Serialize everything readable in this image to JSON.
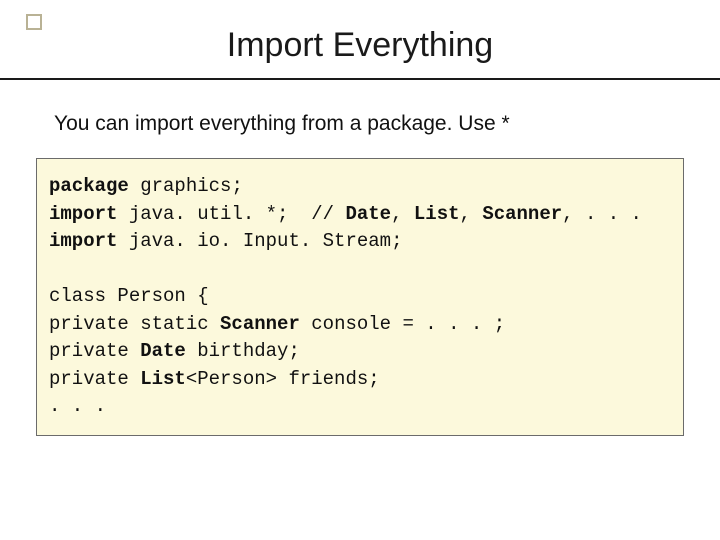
{
  "slide": {
    "title": "Import Everything",
    "subtitle": "You can import everything from a package.  Use *"
  },
  "code": {
    "l1a": "package",
    "l1b": " graphics;",
    "l2a": "import",
    "l2b": " java. util. *;  // ",
    "l2c": "Date",
    "l2d": ", ",
    "l2e": "List",
    "l2f": ", ",
    "l2g": "Scanner",
    "l2h": ", . . .",
    "l3a": "import",
    "l3b": " java. io. Input. Stream;",
    "blank": "",
    "l4": "class Person {",
    "l5a": "private static ",
    "l5b": "Scanner",
    "l5c": " console = . . . ;",
    "l6a": "private ",
    "l6b": "Date",
    "l6c": " birthday;",
    "l7a": "private ",
    "l7b": "List",
    "l7c": "<Person> friends;",
    "l8": ". . ."
  }
}
